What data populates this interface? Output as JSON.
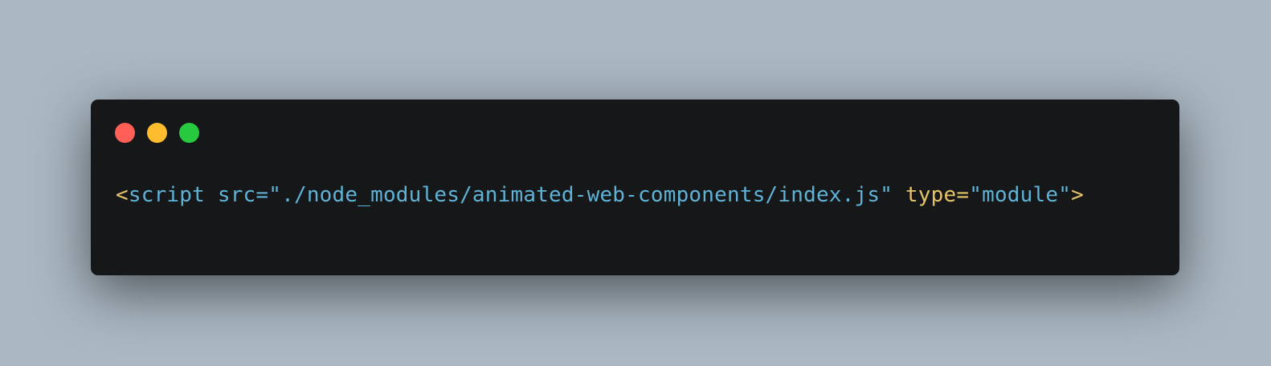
{
  "window": {
    "controls": [
      {
        "name": "close",
        "color": "#ff5f56"
      },
      {
        "name": "minimize",
        "color": "#ffbd2e"
      },
      {
        "name": "maximize",
        "color": "#27c93f"
      }
    ]
  },
  "code": {
    "tokens": [
      {
        "text": "<",
        "color": "yellow"
      },
      {
        "text": "script",
        "color": "blue"
      },
      {
        "text": " ",
        "color": "blue"
      },
      {
        "text": "src",
        "color": "blue"
      },
      {
        "text": "=",
        "color": "blue"
      },
      {
        "text": "\"./node_modules/animated-web-components/index.js\"",
        "color": "blue"
      },
      {
        "text": " ",
        "color": "blue"
      },
      {
        "text": "type",
        "color": "yellow"
      },
      {
        "text": "=",
        "color": "yellow"
      },
      {
        "text": "\"module\"",
        "color": "blue"
      },
      {
        "text": ">",
        "color": "yellow"
      }
    ]
  },
  "colors": {
    "background": "#abb8c3",
    "window": "#161719",
    "yellow": "#e6c46a",
    "blue": "#5eb3d6"
  }
}
